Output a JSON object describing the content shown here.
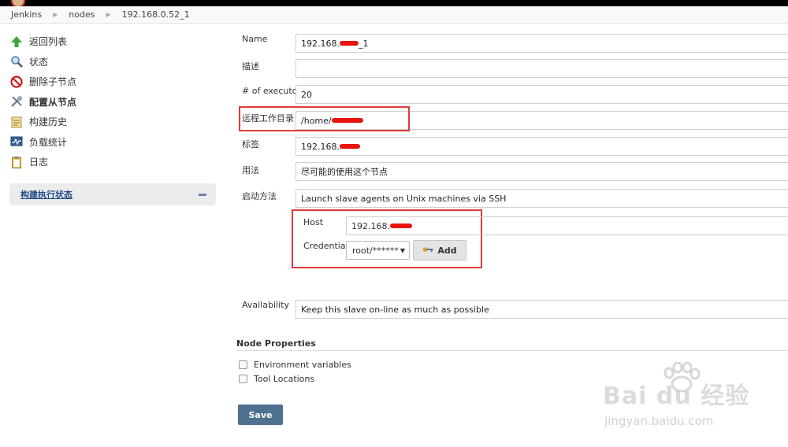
{
  "breadcrumb": [
    "Jenkins",
    "nodes",
    "192.168.0.52_1"
  ],
  "sidebar": {
    "items": [
      {
        "label": "返回列表",
        "icon": "up-arrow-icon"
      },
      {
        "label": "状态",
        "icon": "search-icon"
      },
      {
        "label": "删除子节点",
        "icon": "no-entry-icon"
      },
      {
        "label": "配置从节点",
        "icon": "wrench-icon",
        "active": true
      },
      {
        "label": "构建历史",
        "icon": "notepad-icon"
      },
      {
        "label": "负载统计",
        "icon": "monitor-icon"
      },
      {
        "label": "日志",
        "icon": "clipboard-icon"
      }
    ],
    "executor_panel": {
      "title": "构建执行状态"
    }
  },
  "form": {
    "name": {
      "label": "Name",
      "value_prefix": "192.168.",
      "value_suffix": "_1"
    },
    "description": {
      "label": "描述",
      "value": ""
    },
    "executors": {
      "label": "# of executors",
      "value": "20"
    },
    "remote_dir": {
      "label": "远程工作目录",
      "value_prefix": "/home/"
    },
    "labels": {
      "label": "标签",
      "value_prefix": "192.168."
    },
    "usage": {
      "label": "用法",
      "value": "尽可能的使用这个节点"
    },
    "launch": {
      "label": "启动方法",
      "value": "Launch slave agents on Unix machines via SSH"
    },
    "host": {
      "label": "Host",
      "value_prefix": "192.168."
    },
    "credentials": {
      "label": "Credentials",
      "selected": "root/******",
      "add_label": "Add"
    },
    "availability": {
      "label": "Availability",
      "value": "Keep this slave on-line as much as possible"
    }
  },
  "node_properties": {
    "title": "Node Properties",
    "options": [
      {
        "label": "Environment variables",
        "checked": false
      },
      {
        "label": "Tool Locations",
        "checked": false
      }
    ]
  },
  "save_label": "Save",
  "watermark": {
    "brand": "Bai du 经验",
    "url": "jingyan.baidu.com"
  },
  "colors": {
    "highlight": "#e03a3a",
    "save_button": "#4e7190",
    "redaction": "#e8140c"
  }
}
